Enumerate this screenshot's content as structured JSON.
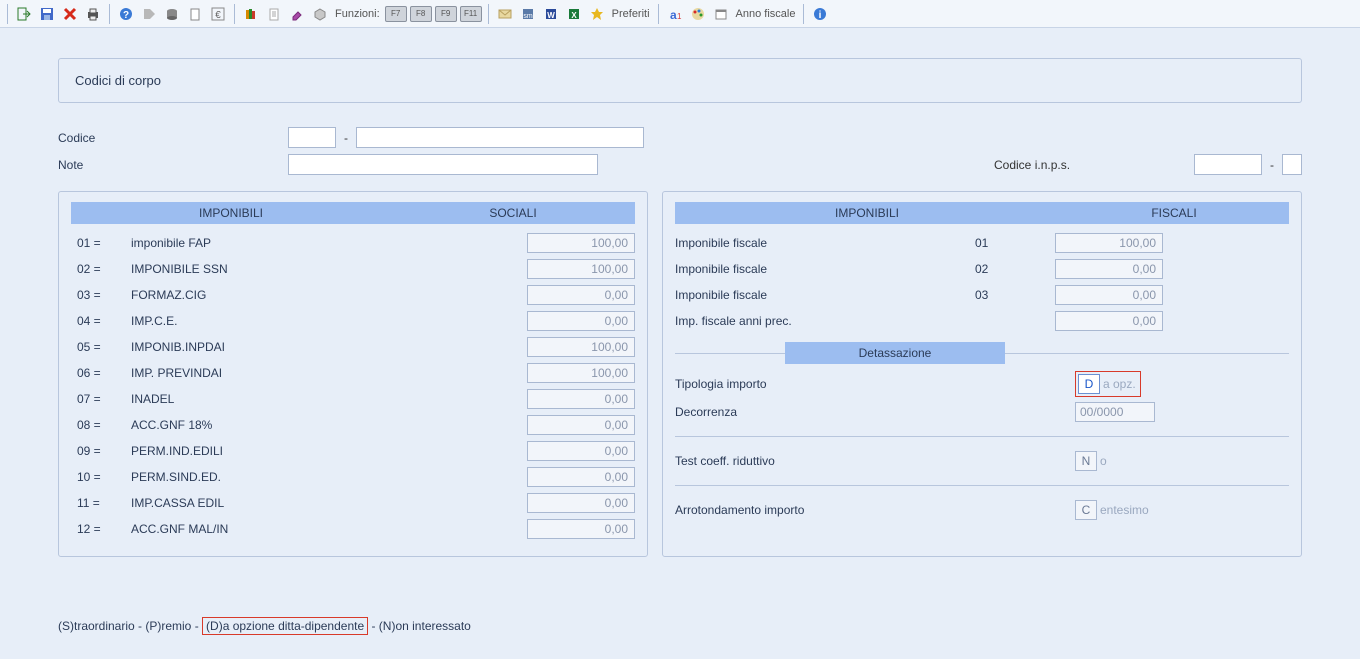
{
  "toolbar": {
    "funzioni_label": "Funzioni:",
    "keys": [
      "F7",
      "F8",
      "F9",
      "F11"
    ],
    "preferiti_label": "Preferiti",
    "anno_fiscale_label": "Anno fiscale"
  },
  "header": {
    "title": "Codici di corpo",
    "codice_label": "Codice",
    "note_label": "Note",
    "codice_inps_label": "Codice i.n.p.s."
  },
  "left_panel": {
    "col1": "IMPONIBILI",
    "col2": "SOCIALI",
    "rows": [
      {
        "code": "01 =",
        "label": "imponibile FAP",
        "value": "100,00"
      },
      {
        "code": "02 =",
        "label": "IMPONIBILE SSN",
        "value": "100,00"
      },
      {
        "code": "03 =",
        "label": "FORMAZ.CIG",
        "value": "0,00"
      },
      {
        "code": "04 =",
        "label": "IMP.C.E.",
        "value": "0,00"
      },
      {
        "code": "05 =",
        "label": "IMPONIB.INPDAI",
        "value": "100,00"
      },
      {
        "code": "06 =",
        "label": "IMP. PREVINDAI",
        "value": "100,00"
      },
      {
        "code": "07 =",
        "label": "INADEL",
        "value": "0,00"
      },
      {
        "code": "08 =",
        "label": "ACC.GNF 18%",
        "value": "0,00"
      },
      {
        "code": "09 =",
        "label": "PERM.IND.EDILI",
        "value": "0,00"
      },
      {
        "code": "10 =",
        "label": "PERM.SIND.ED.",
        "value": "0,00"
      },
      {
        "code": "11 =",
        "label": "IMP.CASSA EDIL",
        "value": "0,00"
      },
      {
        "code": "12 =",
        "label": "ACC.GNF MAL/IN",
        "value": "0,00"
      }
    ]
  },
  "right_panel": {
    "col1": "IMPONIBILI",
    "col2": "FISCALI",
    "rows": [
      {
        "label": "Imponibile fiscale",
        "idx": "01",
        "value": "100,00"
      },
      {
        "label": "Imponibile fiscale",
        "idx": "02",
        "value": "0,00"
      },
      {
        "label": "Imponibile fiscale",
        "idx": "03",
        "value": "0,00"
      },
      {
        "label": "Imp. fiscale anni prec.",
        "idx": "",
        "value": "0,00"
      }
    ],
    "detassazione_label": "Detassazione",
    "tipologia_label": "Tipologia importo",
    "tipologia_code": "D",
    "tipologia_suffix": "a opz.",
    "decorrenza_label": "Decorrenza",
    "decorrenza_value": "00/0000",
    "test_coeff_label": "Test coeff. riduttivo",
    "test_coeff_code": "N",
    "test_coeff_suffix": "o",
    "arrot_label": "Arrotondamento importo",
    "arrot_code": "C",
    "arrot_suffix": "entesimo"
  },
  "footer": {
    "prefix": "(S)traordinario - (P)remio - ",
    "highlighted": "(D)a opzione ditta-dipendente",
    "suffix": " - (N)on interessato"
  }
}
